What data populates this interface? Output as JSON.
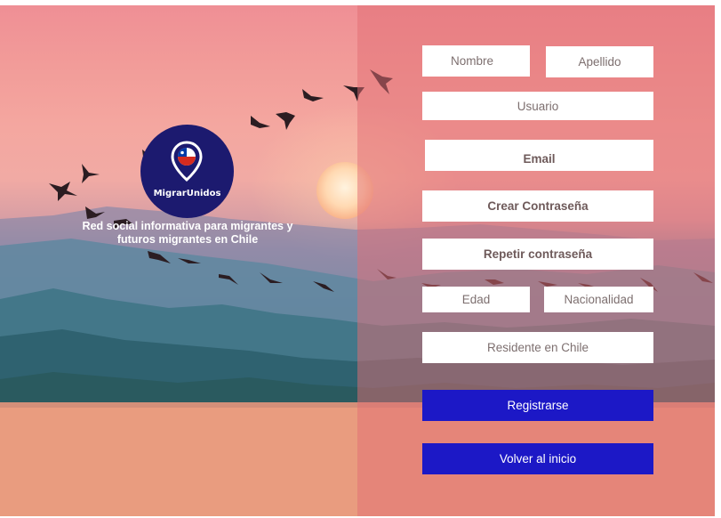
{
  "brand": {
    "name": "MigrarUnidos",
    "tagline_line1": "Red social informativa para migrantes y",
    "tagline_line2": "futuros migrantes  en Chile"
  },
  "form": {
    "nombre": "Nombre",
    "apellido": "Apellido",
    "usuario": "Usuario",
    "email": "Email",
    "crear_contrasena": "Crear Contraseña",
    "repetir_contrasena": "Repetir contraseña",
    "edad": "Edad",
    "nacionalidad": "Nacionalidad",
    "residente": "Residente en Chile"
  },
  "actions": {
    "register": "Registrarse",
    "back": "Volver al inicio"
  },
  "colors": {
    "button": "#1c18c6",
    "logo": "#1c1a6f",
    "panel_tint": "#e26e73"
  }
}
